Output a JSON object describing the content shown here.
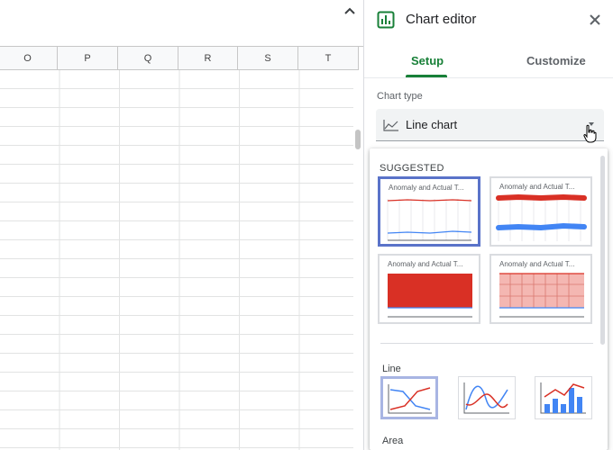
{
  "sheet": {
    "columns": [
      "O",
      "P",
      "Q",
      "R",
      "S",
      "T"
    ]
  },
  "editor": {
    "title": "Chart editor",
    "tabs": [
      {
        "label": "Setup",
        "active": true
      },
      {
        "label": "Customize",
        "active": false
      }
    ],
    "chart_type": {
      "label": "Chart type",
      "value": "Line chart"
    },
    "dropdown": {
      "suggested_title": "SUGGESTED",
      "suggestions": [
        {
          "title": "Anomaly and Actual T...",
          "kind": "line",
          "selected": true
        },
        {
          "title": "Anomaly and Actual T...",
          "kind": "thick-line",
          "selected": false
        },
        {
          "title": "Anomaly and Actual T...",
          "kind": "area",
          "selected": false
        },
        {
          "title": "Anomaly and Actual T...",
          "kind": "area-gridded",
          "selected": false
        }
      ],
      "line_section": {
        "title": "Line",
        "types": [
          {
            "name": "line-chart",
            "selected": true
          },
          {
            "name": "smooth-line-chart",
            "selected": false
          },
          {
            "name": "combo-chart",
            "selected": false
          }
        ]
      },
      "area_section": {
        "title": "Area"
      }
    }
  },
  "colors": {
    "accent_green": "#188038",
    "selected_blue": "#5a73c9",
    "series_red": "#d93025",
    "series_blue": "#4285f4"
  }
}
